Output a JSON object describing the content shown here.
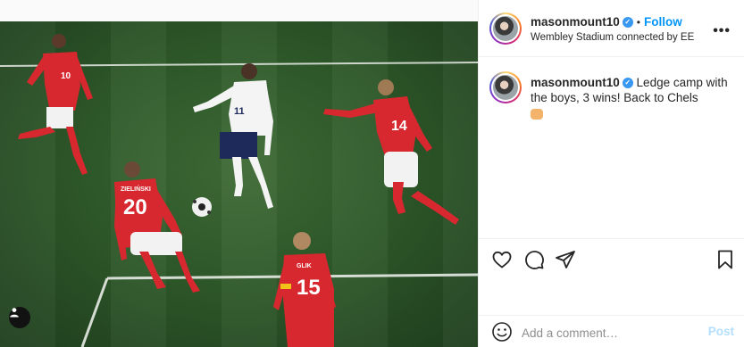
{
  "post": {
    "username": "masonmount10",
    "follow_label": "Follow",
    "separator": "•",
    "location": "Wembley Stadium connected by EE",
    "more_label": "•••",
    "caption": "Ledge camp with the boys, 3 wins! Back to Chels",
    "caption_emoji": "fist-bump-emoji"
  },
  "photo": {
    "description_icons": [
      "user-tag-icon"
    ],
    "shirt_numbers": [
      "10",
      "11",
      "20",
      "14",
      "15"
    ],
    "shirt_names": [
      "ZIELIŃSKI",
      "GLIK"
    ]
  },
  "actions": {
    "like_icon": "heart-icon",
    "comment_icon": "comment-icon",
    "share_icon": "share-icon",
    "save_icon": "bookmark-icon"
  },
  "comment": {
    "emoji_icon": "smiley-icon",
    "placeholder": "Add a comment…",
    "post_label": "Post"
  },
  "colors": {
    "accent": "#0095f6",
    "post_disabled": "#b2dffc",
    "pitch": "#2f5a2a",
    "poland_red": "#d7282f"
  }
}
